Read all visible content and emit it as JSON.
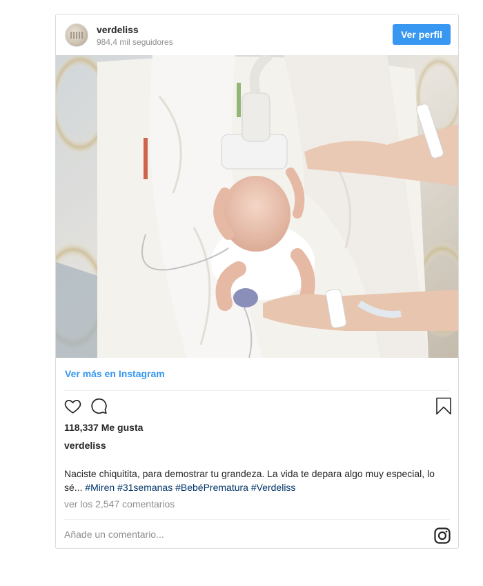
{
  "post": {
    "username": "verdeliss",
    "followers": "984,4 mil seguidores",
    "follow_button": "Ver perfil",
    "more_link": "Ver más en Instagram",
    "likes": "118,337 Me gusta",
    "caption_user": "verdeliss",
    "caption_text": "Naciste chiquitita, para demostrar tu grandeza. La vida te depara algo muy especial, lo sé... ",
    "hashtags": [
      "#Miren",
      "#31semanas",
      "#BebéPrematura",
      "#Verdeliss"
    ],
    "comments_link": "ver los 2,547 comentarios",
    "comment_placeholder": "Añade un comentario..."
  },
  "icons": {
    "like": "heart-icon",
    "comment": "comment-icon",
    "save": "bookmark-icon",
    "brand": "instagram-icon"
  },
  "colors": {
    "accent": "#3897f0",
    "hashtag": "#003569",
    "muted": "#8e8e8e",
    "border": "#dbdbdb"
  }
}
